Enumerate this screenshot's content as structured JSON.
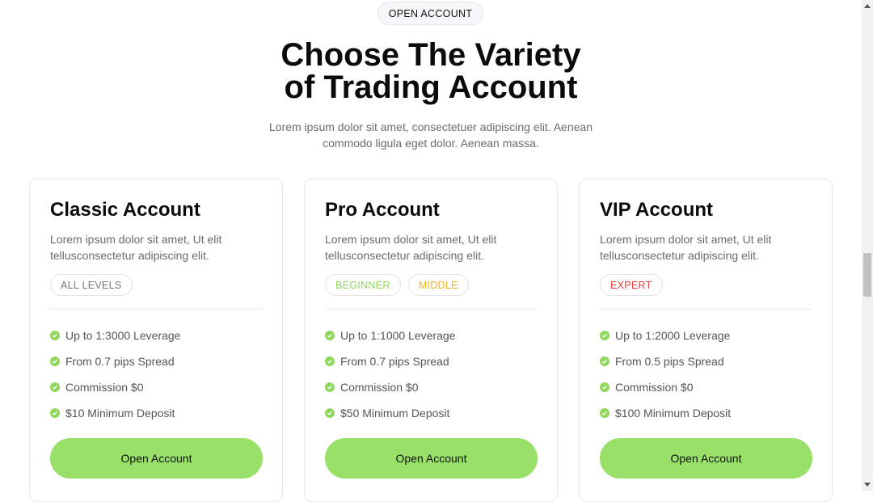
{
  "header": {
    "badge": "OPEN ACCOUNT",
    "title_line1": "Choose The Variety",
    "title_line2": "of Trading Account",
    "subtitle": "Lorem ipsum dolor sit amet, consectetuer adipiscing elit. Aenean commodo ligula eget dolor. Aenean massa."
  },
  "cards": [
    {
      "title": "Classic Account",
      "description": "Lorem ipsum dolor sit amet, Ut elit tellusconsectetur adipiscing elit.",
      "tags": [
        {
          "label": "ALL LEVELS",
          "color": "#777777"
        }
      ],
      "features": [
        "Up to 1:3000 Leverage",
        "From 0.7 pips Spread",
        "Commission $0",
        "$10 Minimum Deposit"
      ],
      "button": "Open Account"
    },
    {
      "title": "Pro Account",
      "description": "Lorem ipsum dolor sit amet, Ut elit tellusconsectetur adipiscing elit.",
      "tags": [
        {
          "label": "BEGINNER",
          "color": "#8fd85c"
        },
        {
          "label": "MIDDLE",
          "color": "#f0b323"
        }
      ],
      "features": [
        "Up to 1:1000 Leverage",
        "From 0.7 pips Spread",
        "Commission $0",
        "$50 Minimum Deposit"
      ],
      "button": "Open Account"
    },
    {
      "title": "VIP Account",
      "description": "Lorem ipsum dolor sit amet, Ut elit tellusconsectetur adipiscing elit.",
      "tags": [
        {
          "label": "EXPERT",
          "color": "#e5413a"
        }
      ],
      "features": [
        "Up to 1:2000 Leverage",
        "From 0.5 pips Spread",
        "Commission $0",
        "$100 Minimum Deposit"
      ],
      "button": "Open Account"
    }
  ],
  "colors": {
    "accent": "#98e068",
    "check": "#8fd85c",
    "text_muted": "#6b6b6b"
  }
}
